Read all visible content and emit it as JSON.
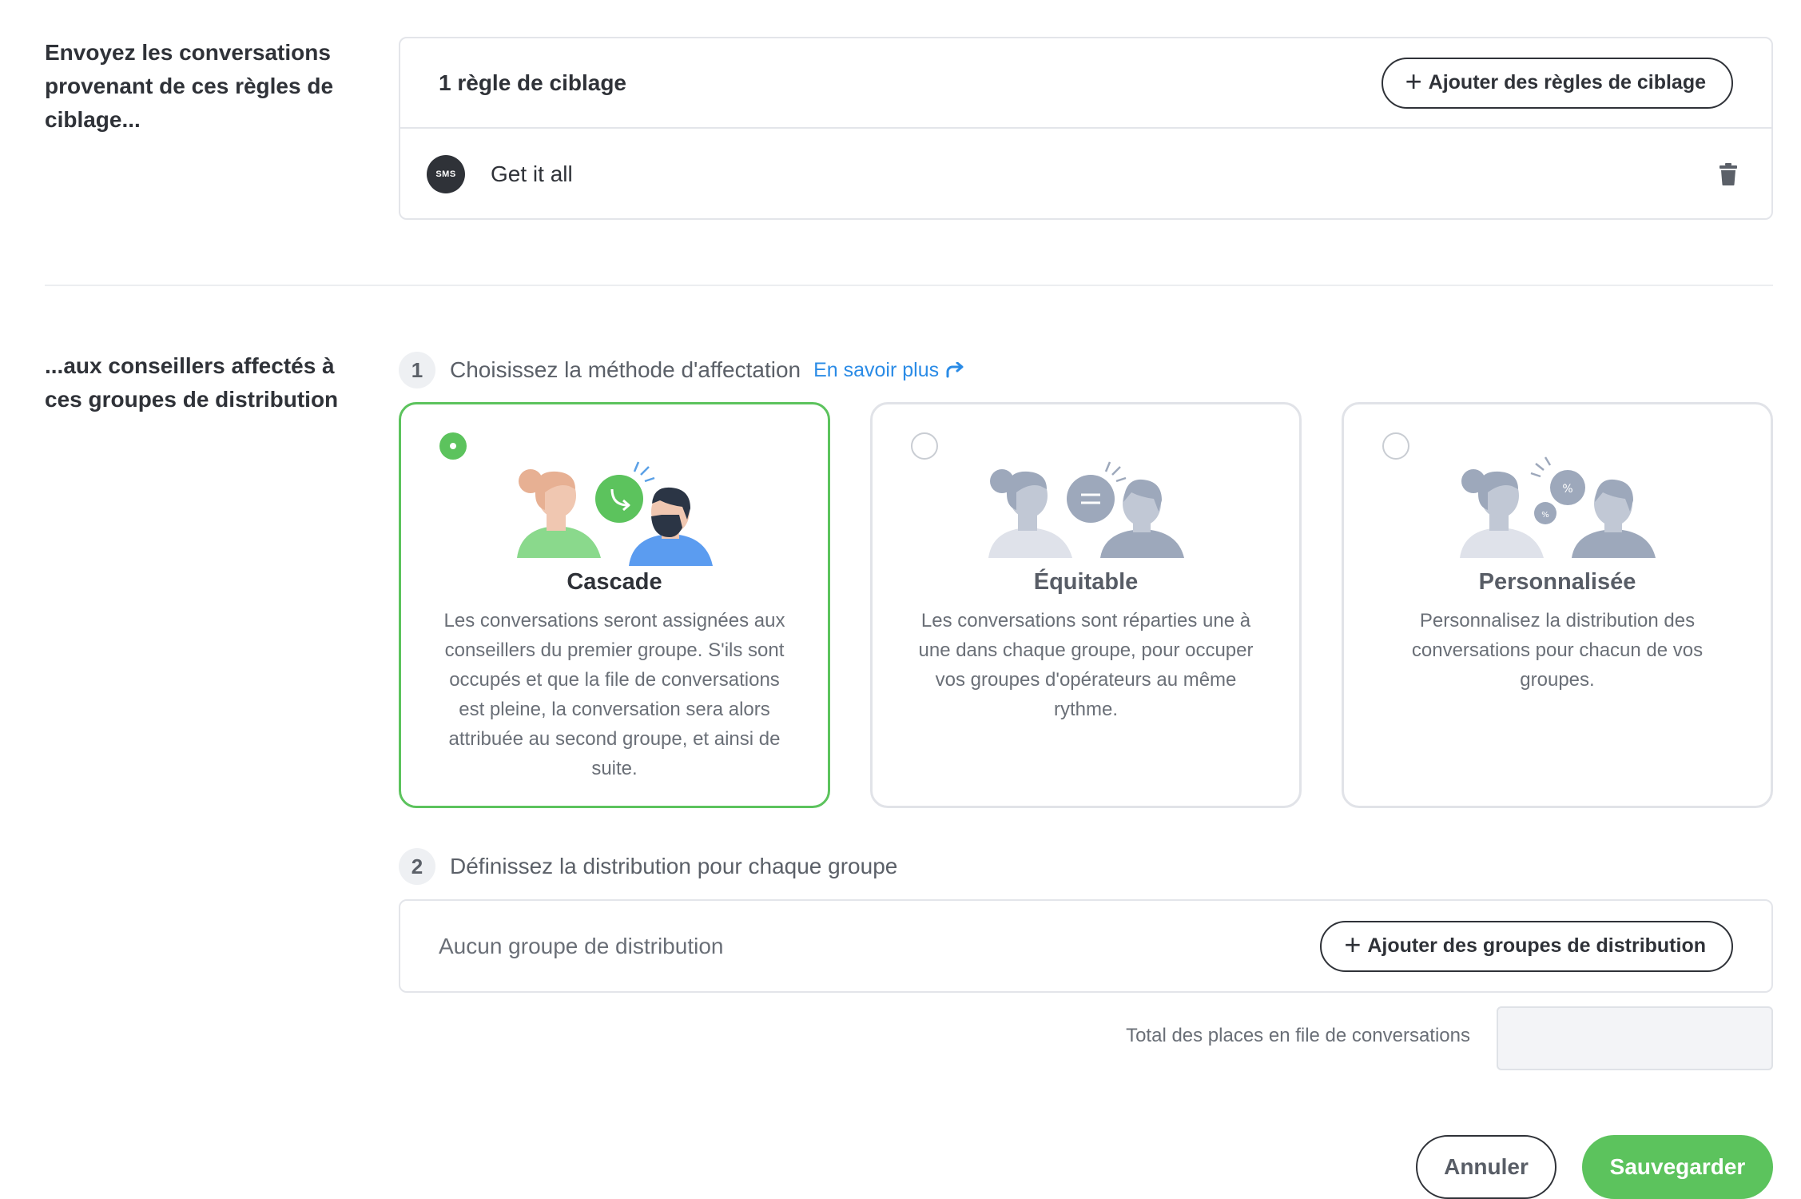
{
  "targeting": {
    "section_label": "Envoyez les conversations provenant de ces règles de ciblage...",
    "count_title": "1 règle de ciblage",
    "add_button": "Ajouter des règles de ciblage",
    "rules": [
      {
        "channel_badge": "SMS",
        "name": "Get it all",
        "icon": "trash-icon"
      }
    ]
  },
  "assignment": {
    "section_label": "...aux conseillers affectés à ces groupes de distribution",
    "step1": {
      "number": "1",
      "label": "Choisissez la méthode d'affectation",
      "link": "En savoir plus"
    },
    "methods": [
      {
        "title": "Cascade",
        "description": "Les conversations seront assignées aux conseillers du premier groupe. S'ils sont occupés et que la file de conversations est pleine, la conversation sera alors attribuée au second groupe, et ainsi de suite.",
        "selected": true
      },
      {
        "title": "Équitable",
        "description": "Les conversations sont réparties une à une dans chaque groupe, pour occuper vos groupes d'opérateurs au même rythme.",
        "selected": false
      },
      {
        "title": "Personnalisée",
        "description": "Personnalisez la distribution des conversations pour chacun de vos groupes.",
        "selected": false
      }
    ],
    "step2": {
      "number": "2",
      "label": "Définissez la distribution pour chaque groupe"
    },
    "distribution": {
      "empty_text": "Aucun groupe de distribution",
      "add_button": "Ajouter des groupes de distribution"
    },
    "total": {
      "label": "Total des places en file de conversations",
      "value": ""
    }
  },
  "actions": {
    "cancel": "Annuler",
    "save": "Sauvegarder"
  },
  "colors": {
    "accent_green": "#5cc35d",
    "link_blue": "#2a8be6",
    "text_dark": "#2f3238",
    "border": "#e3e5ea"
  }
}
